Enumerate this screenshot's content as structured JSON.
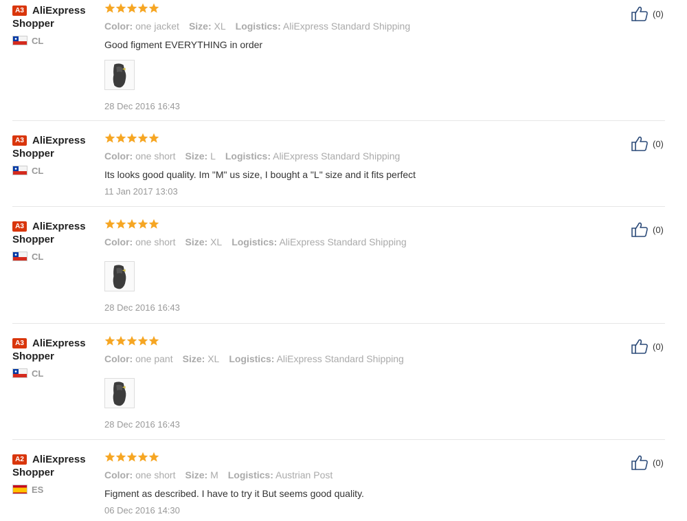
{
  "labels": {
    "color": "Color:",
    "size": "Size:",
    "logistics": "Logistics:"
  },
  "reviews": [
    {
      "level": "A3",
      "name_line1": "AliExpress",
      "name_line2": "Shopper",
      "country_code": "CL",
      "flag": "flag-chile-icon",
      "rating": 5,
      "color": "one jacket",
      "size": "XL",
      "logistics": "AliExpress Standard Shipping",
      "feedback": "Good figment EVERYTHING in order",
      "has_photo": true,
      "date": "28 Dec 2016 16:43",
      "helpful": "(0)"
    },
    {
      "level": "A3",
      "name_line1": "AliExpress",
      "name_line2": "Shopper",
      "country_code": "CL",
      "flag": "flag-chile-icon",
      "rating": 5,
      "color": "one short",
      "size": "L",
      "logistics": "AliExpress Standard Shipping",
      "feedback": "Its looks good quality. Im \"M\" us size, I bought a \"L\" size and it fits perfect",
      "has_photo": false,
      "date": "11 Jan 2017 13:03",
      "helpful": "(0)"
    },
    {
      "level": "A3",
      "name_line1": "AliExpress",
      "name_line2": "Shopper",
      "country_code": "CL",
      "flag": "flag-chile-icon",
      "rating": 5,
      "color": "one short",
      "size": "XL",
      "logistics": "AliExpress Standard Shipping",
      "feedback": "",
      "has_photo": true,
      "date": "28 Dec 2016 16:43",
      "helpful": "(0)"
    },
    {
      "level": "A3",
      "name_line1": "AliExpress",
      "name_line2": "Shopper",
      "country_code": "CL",
      "flag": "flag-chile-icon",
      "rating": 5,
      "color": "one pant",
      "size": "XL",
      "logistics": "AliExpress Standard Shipping",
      "feedback": "",
      "has_photo": true,
      "date": "28 Dec 2016 16:43",
      "helpful": "(0)"
    },
    {
      "level": "A2",
      "name_line1": "AliExpress",
      "name_line2": "Shopper",
      "country_code": "ES",
      "flag": "flag-spain-icon",
      "rating": 5,
      "color": "one short",
      "size": "M",
      "logistics": "Austrian Post",
      "feedback": "Figment as described. I have to try it But seems good quality.",
      "has_photo": false,
      "date": "06 Dec 2016 14:30",
      "helpful": "(0)"
    }
  ],
  "colors": {
    "star": "#f6a623",
    "badge": "#d9360c",
    "muted": "#999999"
  }
}
